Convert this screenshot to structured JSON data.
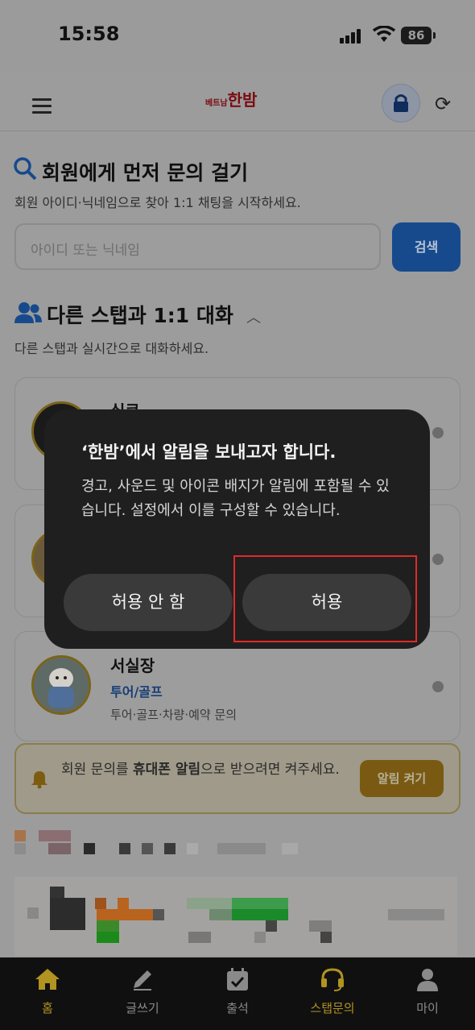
{
  "status_bar": {
    "time": "15:58",
    "battery": "86"
  },
  "header": {
    "logo_small": "베트남",
    "logo_big": "한밤",
    "menu_icon": "hamburger-icon",
    "lock_icon": "lock-icon",
    "refresh_icon": "refresh-icon"
  },
  "search_section": {
    "title": "회원에게 먼저 문의 걸기",
    "description": "회원 아이디·닉네임으로 찾아 1:1 채팅을 시작하세요.",
    "placeholder": "아이디 또는 닉네임",
    "button": "검색"
  },
  "chat_section": {
    "title": "다른 스탭과 1:1 대화",
    "description": "다른 스탭과 실시간으로 대화하세요."
  },
  "cards": [
    {
      "name": "실큐"
    },
    {
      "name": ""
    },
    {
      "name": "서실장",
      "tag": "투어/골프",
      "description": "투어·골프·차량·예약 문의"
    }
  ],
  "notice": {
    "text_before": "회원 문의를 ",
    "text_bold": "휴대폰 알림",
    "text_after": "으로 받으려면 켜주세요.",
    "button": "알림 켜기"
  },
  "tabs": [
    {
      "label": "홈",
      "icon": "home-icon",
      "active": true
    },
    {
      "label": "글쓰기",
      "icon": "pencil-icon",
      "active": false
    },
    {
      "label": "출석",
      "icon": "calendar-check-icon",
      "active": false
    },
    {
      "label": "스탭문의",
      "icon": "headset-icon",
      "active": true
    },
    {
      "label": "마이",
      "icon": "user-icon",
      "active": false
    }
  ],
  "alert": {
    "title": "‘한밤’에서 알림을 보내고자 합니다.",
    "message": "경고, 사운드 및 아이콘 배지가 알림에 포함될 수 있습니다. 설정에서 이를 구성할 수 있습니다.",
    "deny": "허용 안 함",
    "allow": "허용"
  },
  "colors": {
    "accent_blue": "#1e66d9",
    "accent_gold": "#e0a614",
    "highlight_red": "#e02a2a"
  }
}
